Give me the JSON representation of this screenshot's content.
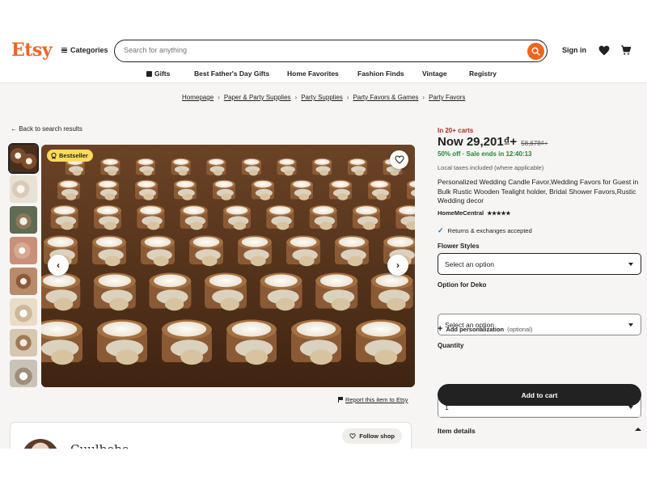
{
  "header": {
    "logo": "Etsy",
    "categories_label": "Categories",
    "search_placeholder": "Search for anything",
    "signin_label": "Sign in",
    "accent_color": "#f1641e"
  },
  "nav": {
    "items": [
      "Gifts",
      "Best Father's Day Gifts",
      "Home Favorites",
      "Fashion Finds",
      "Vintage",
      "Registry"
    ]
  },
  "breadcrumb": {
    "items": [
      "Homepage",
      "Paper & Party Supplies",
      "Party Supplies",
      "Party Favors & Games",
      "Party Favors"
    ],
    "separator": "›"
  },
  "back_link": "← Back to search results",
  "gallery": {
    "badge": "Bestseller",
    "report_link": "Report this item to Etsy",
    "prev_icon": "‹",
    "next_icon": "›",
    "thumbnail_count": 8
  },
  "shop_card": {
    "shop_name": "Cuulbebe",
    "follow_label": "Follow shop"
  },
  "product": {
    "carts_text": "In 20+ carts",
    "price": "Now 29,201₫+",
    "old_price": "58,678₫+",
    "sale_text": "50% off · Sale ends in 12:40:13",
    "taxes_text": "Local taxes included (where applicable)",
    "title": "Personalized Wedding Candle Favor,Wedding Favors for Guest in Bulk Rustic Wooden Tealight holder, Bridal Shower Favors,Rustic Wedding decor",
    "seller": "HomeMeCentral",
    "stars": "★★★★★",
    "returns_text": "Returns & exchanges accepted",
    "sale_color": "#258635",
    "carts_color": "#b3261e"
  },
  "options": {
    "flower_label": "Flower Styles",
    "flower_value": "Select an option",
    "deko_label": "Option for Deko",
    "deko_value": "Select an option",
    "personalization_label": "Add personalization",
    "personalization_optional": "(optional)",
    "quantity_label": "Quantity",
    "quantity_value": "1"
  },
  "actions": {
    "add_to_cart": "Add to cart",
    "item_details": "Item details"
  }
}
